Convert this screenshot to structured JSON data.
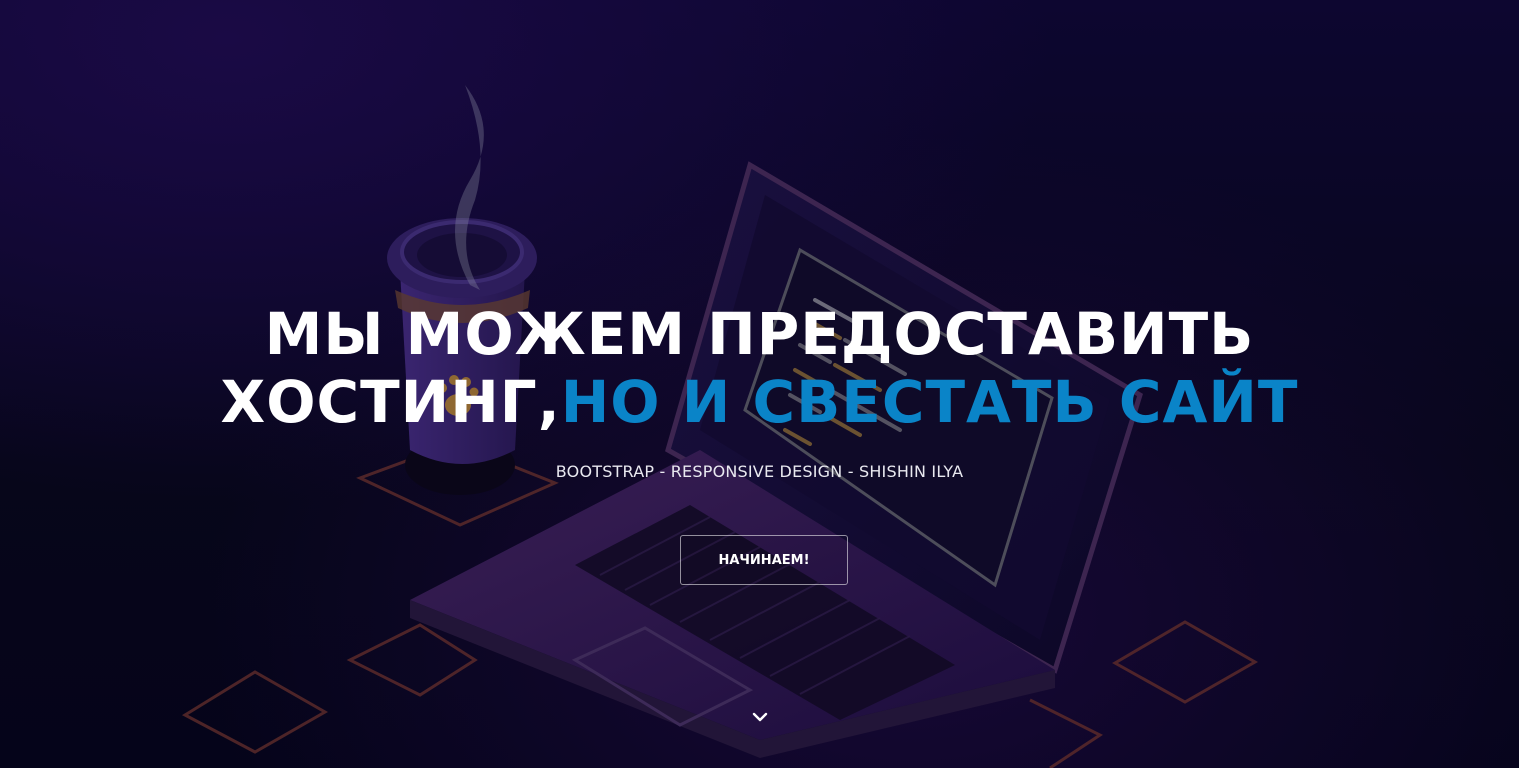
{
  "hero": {
    "headline_main": "МЫ МОЖЕМ ПРЕДОСТАВИТЬ ХОСТИНГ,",
    "headline_accent": "НО И СВЕСТАТЬ САЙТ",
    "subtitle": "BOOTSTRAP - RESPONSIVE DESIGN - SHISHIN ILYA",
    "cta_label": "НАЧИНАЕМ!",
    "scroll_icon": "chevron-down-icon"
  },
  "colors": {
    "background": "#07061a",
    "accent": "#0a84c8",
    "text": "#ffffff"
  }
}
